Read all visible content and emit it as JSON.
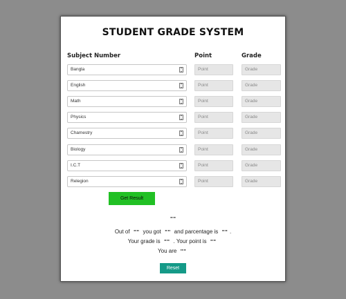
{
  "title": "STUDENT GRADE SYSTEM",
  "columns": {
    "subject": "Subject Number",
    "point": "Point",
    "grade": "Grade"
  },
  "subjects": [
    {
      "name": "Bangla",
      "point": "Point",
      "grade": "Grade"
    },
    {
      "name": "English",
      "point": "Point",
      "grade": "Grade"
    },
    {
      "name": "Math",
      "point": "Point",
      "grade": "Grade"
    },
    {
      "name": "Physics",
      "point": "Point",
      "grade": "Grade"
    },
    {
      "name": "Chamestry",
      "point": "Point",
      "grade": "Grade"
    },
    {
      "name": "Biology",
      "point": "Point",
      "grade": "Grade"
    },
    {
      "name": "I.C.T",
      "point": "Point",
      "grade": "Grade"
    },
    {
      "name": "Relegion",
      "point": "Point",
      "grade": "Grade"
    }
  ],
  "buttons": {
    "get_result": "Get Result",
    "reset": "Reset"
  },
  "result": {
    "name_placeholder": "\"\"",
    "out_of_label": "Out of",
    "out_of_value": "\"\"",
    "you_got_label": "you got",
    "you_got_value": "\"\"",
    "percentage_label": "and parcentage is",
    "percentage_value": "\"\"",
    "percentage_end": ".",
    "grade_label": "Your grade is",
    "grade_value": "\"\"",
    "point_label": ". Your point is",
    "point_value": "\"\"",
    "you_are_label": "You are",
    "you_are_value": "\"\""
  }
}
